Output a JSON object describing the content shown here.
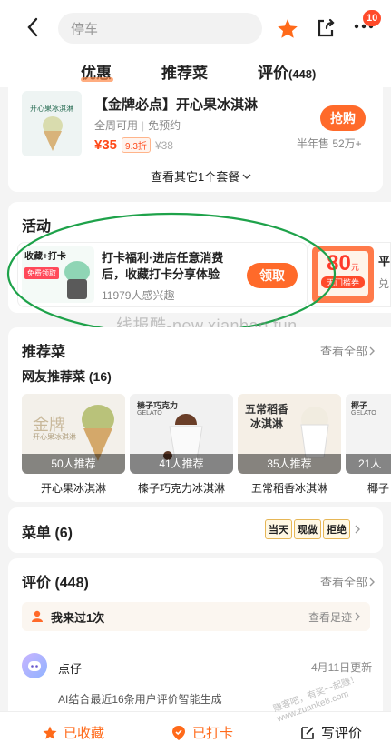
{
  "header": {
    "search_placeholder": "停车",
    "badge_count": "10"
  },
  "tabs": [
    {
      "label": "优惠",
      "active": true
    },
    {
      "label": "推荐菜",
      "active": false
    },
    {
      "label": "评价",
      "count": "(448)",
      "active": false
    }
  ],
  "deal": {
    "title": "【金牌必点】开心果冰淇淋",
    "meta_1": "全周可用",
    "meta_2": "免预约",
    "price": "¥35",
    "discount": "9.3折",
    "orig_price": "¥38",
    "buy_label": "抢购",
    "sales": "半年售 52万+",
    "thumb_text": "开心果冰淇淋",
    "more_label": "查看其它1个套餐"
  },
  "activity": {
    "section_title": "活动",
    "thumb_line1": "收藏+打卡",
    "thumb_line2": "免费领取",
    "title": "打卡福利·进店任意消费后，收藏打卡分享体验",
    "interest": "11979人感兴趣",
    "claim_label": "领取",
    "coupon_num": "80",
    "coupon_unit": "元",
    "coupon_sub": "无门槛券",
    "next_char_1": "平",
    "next_char_2": "兑"
  },
  "watermark": "线报酷-new.xianbao.fun",
  "dishes": {
    "section_title": "推荐菜",
    "view_all": "查看全部",
    "subtitle": "网友推荐菜 (16)",
    "items": [
      {
        "name": "开心果冰淇淋",
        "badge": "50人推荐",
        "tag": "金牌",
        "tag2": "开心果冰淇淋"
      },
      {
        "name": "榛子巧克力冰淇淋",
        "badge": "41人推荐",
        "tag": "榛子巧克力",
        "tag2": "GELATO"
      },
      {
        "name": "五常稻香冰淇淋",
        "badge": "35人推荐",
        "tag": "五常稻香",
        "tag2": "冰淇淋"
      },
      {
        "name": "椰子",
        "badge": "21人",
        "tag": "椰子",
        "tag2": "GELATO"
      }
    ]
  },
  "menu": {
    "title": "菜单 (6)",
    "chips": [
      "当天",
      "现做",
      "拒绝"
    ]
  },
  "reviews": {
    "title": "评价 (448)",
    "view_all": "查看全部",
    "visited": "我来过1次",
    "footprint": "查看足迹",
    "ai_name": "点仔",
    "ai_date": "4月11日更新",
    "ai_text": "AI结合最近16条用户评价智能生成"
  },
  "bottom_bar": {
    "fav": "已收藏",
    "checkin": "已打卡",
    "review": "写评价"
  },
  "corner_watermark": "赚客吧，有奖一起赚！ www.zuanke8.com"
}
